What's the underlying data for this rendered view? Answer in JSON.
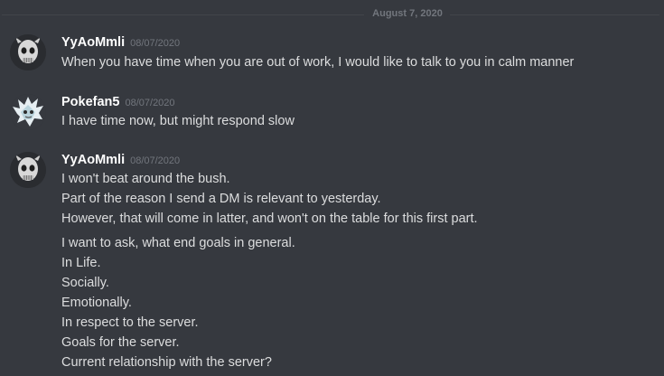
{
  "divider": {
    "date": "August 7, 2020"
  },
  "messages": [
    {
      "author": "YyAoMmli",
      "timestamp": "08/07/2020",
      "lines": [
        "When you have time when you are out of work, I would like to talk to you in calm manner"
      ]
    },
    {
      "author": "Pokefan5",
      "timestamp": "08/07/2020",
      "lines": [
        "I have time now, but might respond slow"
      ]
    },
    {
      "author": "YyAoMmli",
      "timestamp": "08/07/2020",
      "lines": [
        "I won't beat around the bush.",
        "Part of the reason I send a DM is relevant to yesterday.",
        "However, that will come in latter, and won't on the table for this first part.",
        "I want to ask, what end goals in general.",
        "In Life.",
        "Socially.",
        "Emotionally.",
        "In respect to the server.",
        "Goals for the server.",
        "Current relationship with the server?"
      ]
    }
  ],
  "colors": {
    "background": "#36393f",
    "author": "#ffffff",
    "text": "#dcddde",
    "muted": "#72767d"
  }
}
